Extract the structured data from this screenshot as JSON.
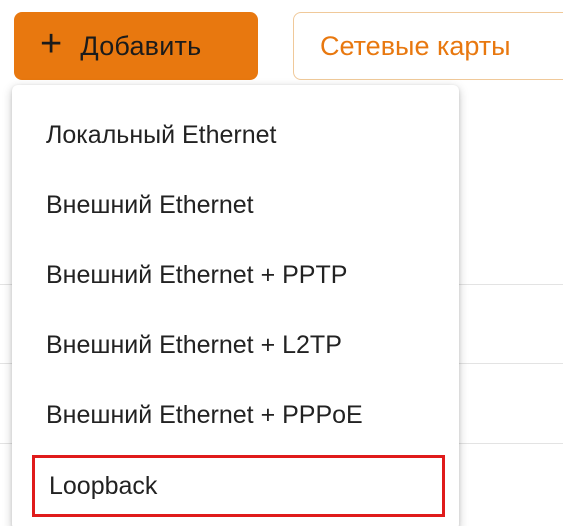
{
  "toolbar": {
    "add_icon": "plus-icon",
    "add_label": "Добавить",
    "network_cards_label": "Сетевые карты"
  },
  "dropdown": {
    "items": [
      {
        "label": "Локальный Ethernet"
      },
      {
        "label": "Внешний Ethernet"
      },
      {
        "label": "Внешний Ethernet + PPTP"
      },
      {
        "label": "Внешний Ethernet + L2TP"
      },
      {
        "label": "Внешний Ethernet + PPPoE"
      },
      {
        "label": "Loopback",
        "highlighted": true
      }
    ]
  },
  "colors": {
    "accent": "#e8780f",
    "highlight_border": "#e01b1b"
  }
}
